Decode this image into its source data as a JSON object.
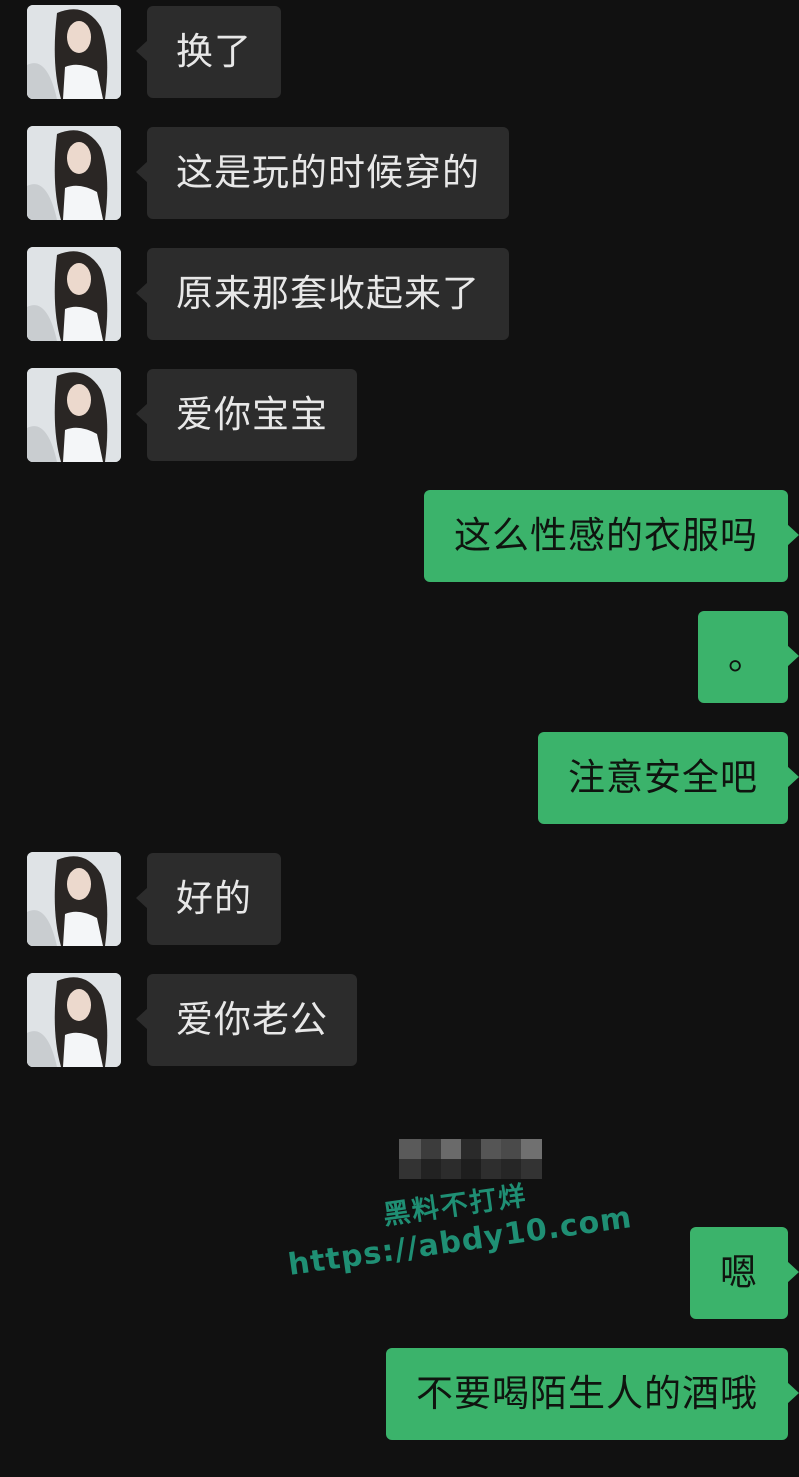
{
  "conversation": {
    "incoming_1": "换了",
    "incoming_2": "这是玩的时候穿的",
    "incoming_3": "原来那套收起来了",
    "incoming_4": "爱你宝宝",
    "outgoing_1": "这么性感的衣服吗",
    "outgoing_2": "。",
    "outgoing_3": "注意安全吧",
    "incoming_5": "好的",
    "incoming_6": "爱你老公",
    "outgoing_4": "嗯",
    "outgoing_5": "不要喝陌生人的酒哦"
  },
  "watermark": {
    "line1": "黑料不打烊",
    "line2": "https://abdy10.com"
  },
  "colors": {
    "background": "#111111",
    "incoming_bubble": "#2c2c2c",
    "outgoing_bubble": "#3bb36b",
    "watermark": "#1f8f74"
  }
}
